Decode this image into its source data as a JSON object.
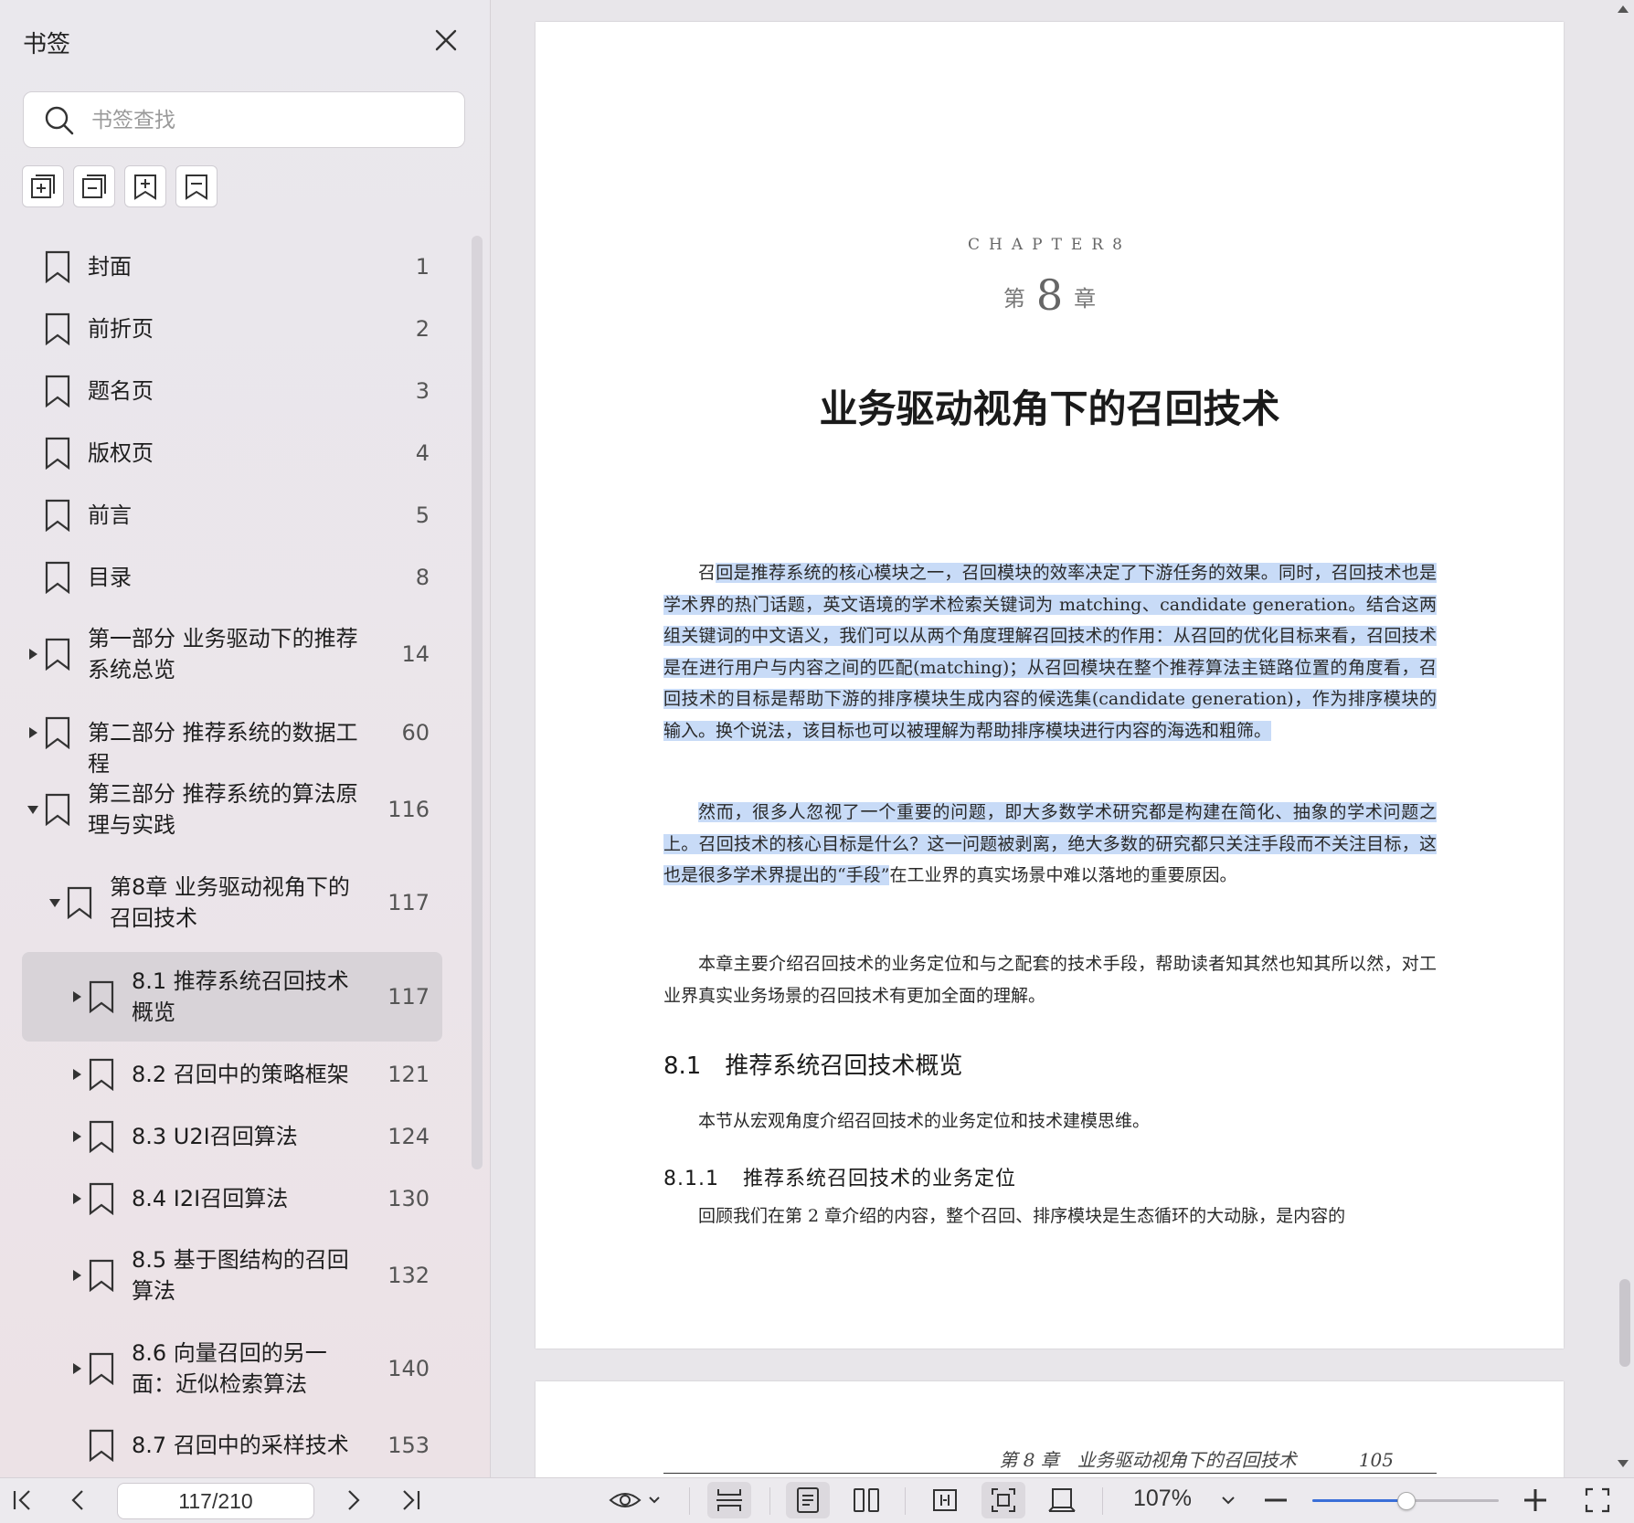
{
  "sidebar": {
    "title": "书签",
    "search_placeholder": "书签查找",
    "tools": [
      "expand-all",
      "collapse-all",
      "add-bookmark",
      "bookmark"
    ],
    "items": [
      {
        "label": "封面",
        "page": "1",
        "level": 0,
        "arrow": "none"
      },
      {
        "label": "前折页",
        "page": "2",
        "level": 0,
        "arrow": "none"
      },
      {
        "label": "题名页",
        "page": "3",
        "level": 0,
        "arrow": "none"
      },
      {
        "label": "版权页",
        "page": "4",
        "level": 0,
        "arrow": "none"
      },
      {
        "label": "前言",
        "page": "5",
        "level": 0,
        "arrow": "none"
      },
      {
        "label": "目录",
        "page": "8",
        "level": 0,
        "arrow": "none"
      },
      {
        "label": "第一部分 业务驱动下的推荐系统总览",
        "page": "14",
        "level": 0,
        "arrow": "right"
      },
      {
        "label": "第二部分 推荐系统的数据工程",
        "page": "60",
        "level": 0,
        "arrow": "right"
      },
      {
        "label": "第三部分 推荐系统的算法原理与实践",
        "page": "116",
        "level": 0,
        "arrow": "down"
      },
      {
        "label": "第8章 业务驱动视角下的召回技术",
        "page": "117",
        "level": 1,
        "arrow": "down"
      },
      {
        "label": "8.1 推荐系统召回技术概览",
        "page": "117",
        "level": 2,
        "arrow": "right",
        "selected": true
      },
      {
        "label": "8.2 召回中的策略框架",
        "page": "121",
        "level": 2,
        "arrow": "right"
      },
      {
        "label": "8.3 U2I召回算法",
        "page": "124",
        "level": 2,
        "arrow": "right"
      },
      {
        "label": "8.4 I2I召回算法",
        "page": "130",
        "level": 2,
        "arrow": "right"
      },
      {
        "label": "8.5 基于图结构的召回算法",
        "page": "132",
        "level": 2,
        "arrow": "right"
      },
      {
        "label": "8.6 向量召回的另一面：近似检索算法",
        "page": "140",
        "level": 2,
        "arrow": "right"
      },
      {
        "label": "8.7 召回中的采样技术",
        "page": "153",
        "level": 2,
        "arrow": "none"
      }
    ]
  },
  "document": {
    "chapter_en": "CHAPTER8",
    "chapter_prefix": "第",
    "chapter_num": "8",
    "chapter_suffix": "章",
    "chapter_title": "业务驱动视角下的召回技术",
    "para1": [
      {
        "t": "召",
        "hl": false
      },
      {
        "t": "回是推荐系统的核心模块之一，召回模块的效率决定了下游任务的效果。同时，召回技术也是学术界的热门话题，英文语境的学术检索关键词为 matching、candidate generation。结合这两组关键词的中文语义，我们可以从两个角度理解召回技术的作用：从召回的优化目标来看，召回技术是在进行用户与内容之间的匹配(matching)；从召回模块在整个推荐算法主链路位置的角度看，召回技术的目标是帮助下游的排序模块生成内容的候选集(candidate generation)，作为排序模块的输入。换个说法，该目标也可以被理解为帮助排序模块进行内容的海选和粗筛。",
        "hl": true
      }
    ],
    "para2": [
      {
        "t": "然而，很多人忽视了一个重要的问题，即大多数学术研究都是构建在简化、抽象的学术问题之上。召回技术的核心目标是什么？这一问题被剥离，绝大多数的研究都只关注手段而不关注目标，这也是很多学术界提出的“手段”",
        "hl": true
      },
      {
        "t": "在工业界的真实场景中难以落地的重要原因。",
        "hl": false
      }
    ],
    "para3": "本章主要介绍召回技术的业务定位和与之配套的技术手段，帮助读者知其然也知其所以然，对工业界真实业务场景的召回技术有更加全面的理解。",
    "sec_81_num": "8.1",
    "sec_81_title": "推荐系统召回技术概览",
    "para4": "本节从宏观角度介绍召回技术的业务定位和技术建模思维。",
    "sec_811_num": "8.1.1",
    "sec_811_title": "推荐系统召回技术的业务定位",
    "para5": "回顾我们在第 2 章介绍的内容，整个召回、排序模块是生态循环的大动脉，是内容的",
    "running_head": "第 8 章　业务驱动视角下的召回技术",
    "running_page": "105"
  },
  "toolbar": {
    "page_value": "117/210",
    "zoom_level": "107%",
    "zoom_fraction": 0.5,
    "accent_color": "#3a6fd8"
  }
}
